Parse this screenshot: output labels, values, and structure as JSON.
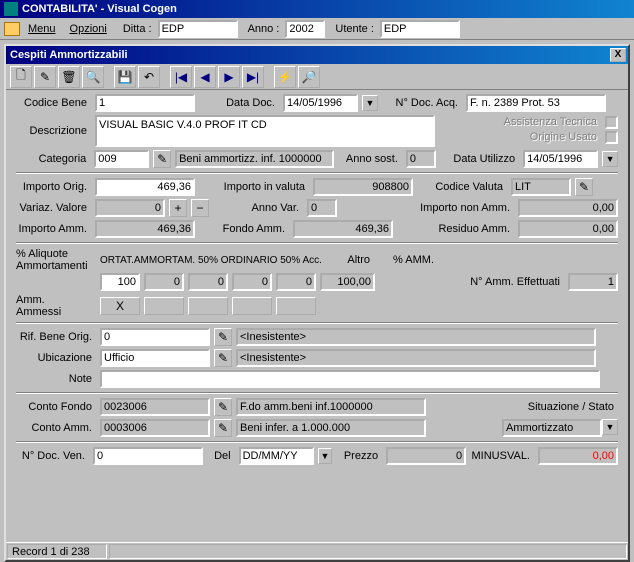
{
  "app": {
    "title": "CONTABILITA' - Visual Cogen"
  },
  "menubar": {
    "menu": "Menu",
    "opzioni": "Opzioni",
    "ditta_lbl": "Ditta :",
    "ditta_val": "EDP",
    "anno_lbl": "Anno :",
    "anno_val": "2002",
    "utente_lbl": "Utente :",
    "utente_val": "EDP"
  },
  "child": {
    "title": "Cespiti Ammortizzabili",
    "close": "X"
  },
  "tb": {
    "new": "🗋",
    "edit": "✎",
    "del": "🗑",
    "find": "🔍",
    "save": "💾",
    "undo": "↶",
    "first": "|◀",
    "prev": "◀",
    "next": "▶",
    "last": "▶|",
    "filter": "⚡",
    "zoom": "🔎"
  },
  "f": {
    "codice_bene_lbl": "Codice Bene",
    "codice_bene": "1",
    "data_doc_lbl": "Data Doc.",
    "data_doc": "14/05/1996",
    "ndoc_acq_lbl": "N° Doc. Acq.",
    "ndoc_acq": "F. n. 2389 Prot. 53",
    "descrizione_lbl": "Descrizione",
    "descrizione": "VISUAL BASIC V.4.0 PROF IT CD",
    "ass_tecnica_lbl": "Assistenza Tecnica",
    "origine_usato_lbl": "Origine Usato",
    "categoria_lbl": "Categoria",
    "categoria": "009",
    "categoria_desc": "Beni ammortizz. inf. 1000000",
    "anno_sost_lbl": "Anno sost.",
    "anno_sost": "0",
    "data_utilizzo_lbl": "Data Utilizzo",
    "data_utilizzo": "14/05/1996",
    "importo_orig_lbl": "Importo Orig.",
    "importo_orig": "469,36",
    "importo_valuta_lbl": "Importo in valuta",
    "importo_valuta": "908800",
    "codice_valuta_lbl": "Codice Valuta",
    "codice_valuta": "LIT",
    "variaz_valore_lbl": "Variaz. Valore",
    "variaz_valore": "0",
    "anno_var_lbl": "Anno Var.",
    "anno_var": "0",
    "importo_non_amm_lbl": "Importo non Amm.",
    "importo_non_amm": "0,00",
    "importo_amm_lbl": "Importo Amm.",
    "importo_amm": "469,36",
    "fondo_amm_lbl": "Fondo Amm.",
    "fondo_amm": "469,36",
    "residuo_amm_lbl": "Residuo Amm.",
    "residuo_amm": "0,00",
    "aliquote_lbl": "% Aliquote Ammortamenti",
    "aliquote_head": "ORTAT.AMMORTAM. 50% ORDINARIO 50% Acc.",
    "altro_lbl": "Altro",
    "pamm_lbl": "% AMM.",
    "a1": "100",
    "a2": "0",
    "a3": "0",
    "a4": "0",
    "a5": "0",
    "a6": "100,00",
    "namm_eff_lbl": "N° Amm. Effettuati",
    "namm_eff": "1",
    "amm_ammessi_lbl": "Amm. Ammessi",
    "rif_bene_lbl": "Rif. Bene Orig.",
    "rif_bene": "0",
    "rif_bene_desc": "<Inesistente>",
    "ubicazione_lbl": "Ubicazione",
    "ubicazione": "Ufficio",
    "ubicazione_desc": "<Inesistente>",
    "note_lbl": "Note",
    "note": "",
    "conto_fondo_lbl": "Conto Fondo",
    "conto_fondo": "0023006",
    "conto_fondo_desc": "F.do amm.beni inf.1000000",
    "conto_amm_lbl": "Conto Amm.",
    "conto_amm": "0003006",
    "conto_amm_desc": "Beni infer. a 1.000.000",
    "sit_stato_lbl": "Situazione / Stato",
    "sit_stato": "Ammortizzato",
    "ndoc_ven_lbl": "N° Doc. Ven.",
    "ndoc_ven": "0",
    "del_lbl": "Del",
    "del_val": "DD/MM/YY",
    "prezzo_lbl": "Prezzo",
    "prezzo": "0",
    "minusval_lbl": "MINUSVAL.",
    "minusval": "0,00"
  },
  "status": {
    "record": "Record 1 di 238"
  }
}
